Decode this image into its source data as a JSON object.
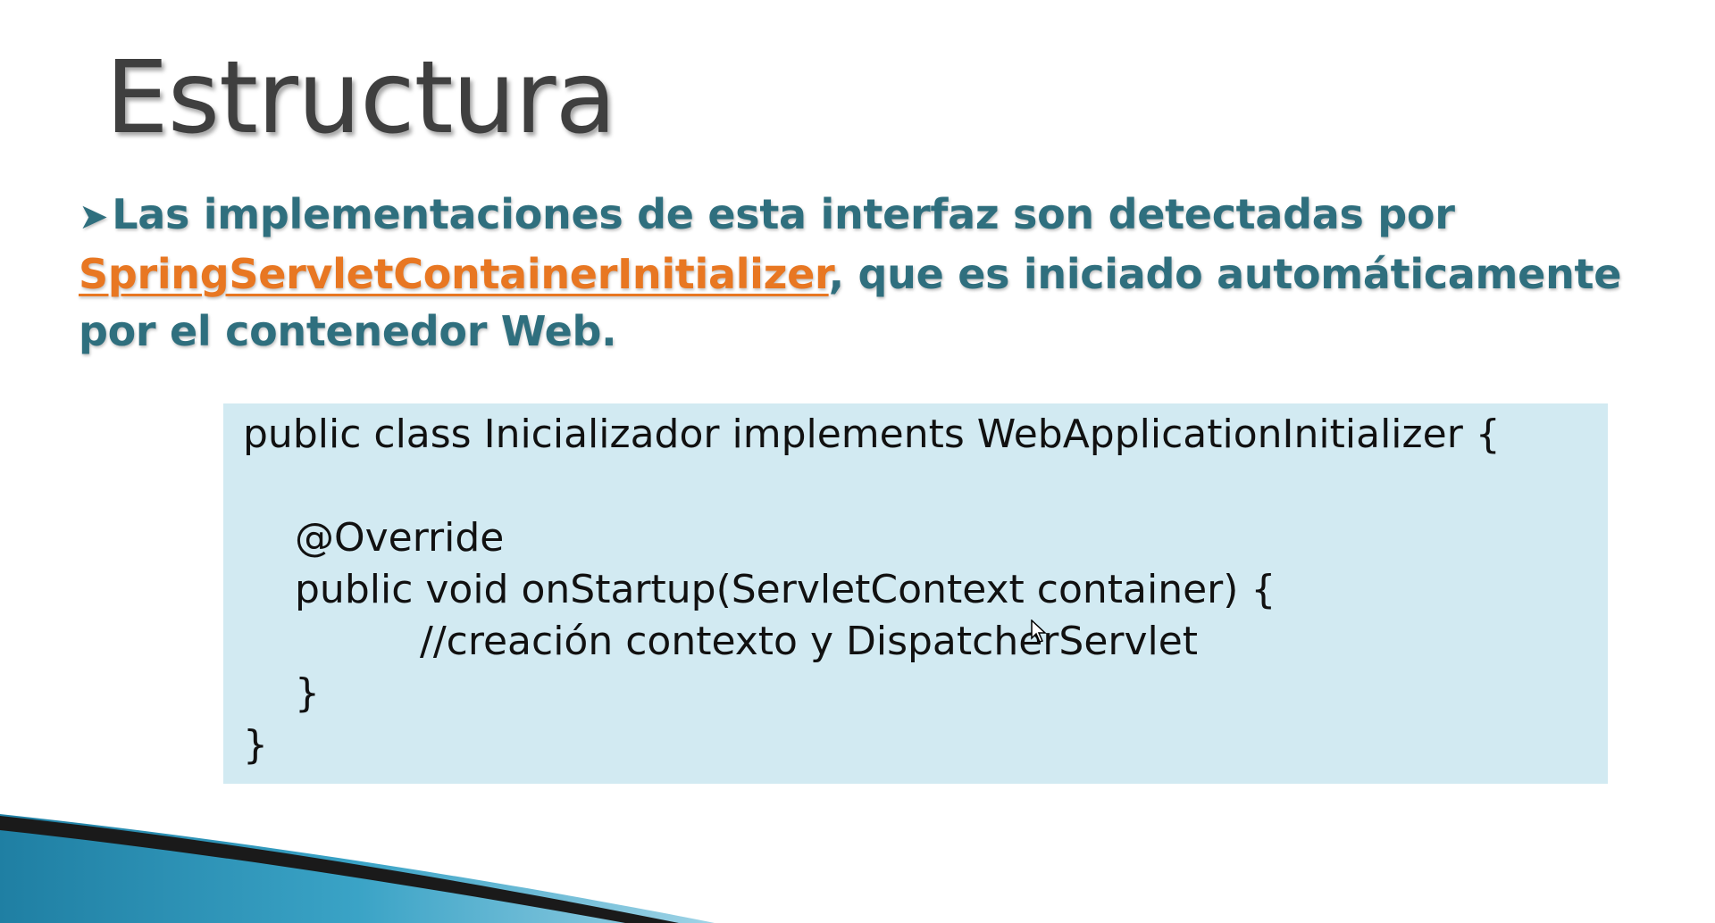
{
  "slide": {
    "title": "Estructura",
    "bullet": {
      "arrow_icon": "arrow-bullet-icon",
      "text_before": "Las implementaciones de esta interfaz son detectadas por ",
      "link_text": "SpringServletContainerInitializer",
      "text_after": ", que es iniciado automáticamente por el contenedor Web."
    },
    "code": {
      "lines": [
        "public class Inicializador implements WebApplicationInitializer {",
        "@Override",
        "public void onStartup(ServletContext container) {",
        "//creación contexto y DispatcherServlet",
        "}",
        "}"
      ]
    },
    "colors": {
      "title": "#3f3f3f",
      "bullet_text": "#2f6f7e",
      "link": "#e87722",
      "code_background": "#d2eaf2",
      "swoosh_dark": "#1a1a1a",
      "swoosh_blue": "#2a8fb0"
    }
  }
}
